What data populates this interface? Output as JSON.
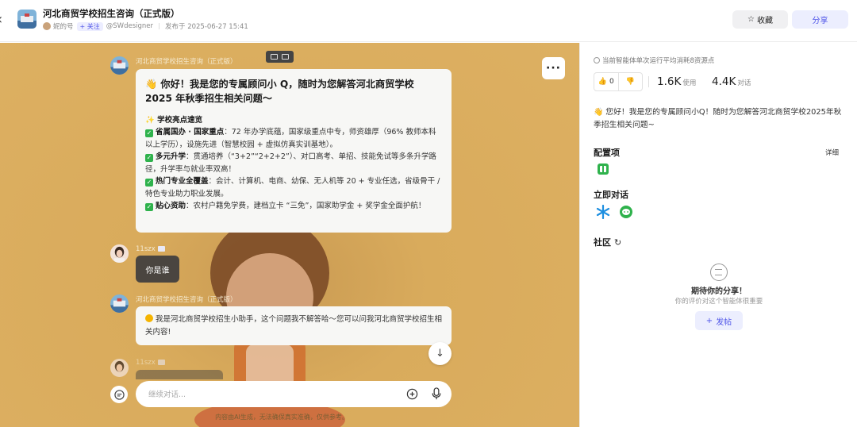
{
  "header": {
    "title": "河北商贸学校招生咨询（正式版）",
    "author": "妮的号",
    "follow_label": "+ 关注",
    "handle": "@SWdesigner",
    "published": "发布于 2025-06-27 15:41",
    "favorite_label": "收藏",
    "share_label": "分享"
  },
  "chat": {
    "bot_name": "河北商贸学校招生咨询（正式版）",
    "user_name": "11szx",
    "welcome": {
      "headline": "你好！我是您的专属顾问小 Q，随时为您解答河北商贸学校 2025 年秋季招生相关问题～",
      "section_title": "学校亮点速览",
      "points": [
        {
          "title": "省属国办 · 国家重点",
          "text": "：72 年办学底蕴，国家级重点中专，师资雄厚（96% 教师本科以上学历），设施先进（智慧校园 + 虚拟仿真实训基地）。"
        },
        {
          "title": "多元升学",
          "text": "：贯通培养（“3+2”“2+2+2”）、对口高考、单招、技能免试等多条升学路径，升学率与就业率双高！"
        },
        {
          "title": "热门专业全覆盖",
          "text": "：会计、计算机、电商、幼保、无人机等 20 + 专业任选，省级骨干 / 特色专业助力职业发展。"
        },
        {
          "title": "贴心资助",
          "text": "：农村户籍免学费，建档立卡 “三免”，国家助学金 + 奖学金全面护航！"
        }
      ]
    },
    "user_message": "你是谁",
    "bot_reply": "我是河北商贸学校招生小助手，这个问题我不解答哈～您可以问我河北商贸学校招生相关内容!",
    "input_placeholder": "继续对话...",
    "disclaimer": "内容由AI生成，无法确保真实准确，仅供参考。"
  },
  "sidebar": {
    "cost_note": "当前智能体单次运行平均消耗8资源点",
    "likes": "0",
    "uses_value": "1.6K",
    "uses_label": "使用",
    "chats_value": "4.4K",
    "chats_label": "对话",
    "greeting": "👋 您好！我是您的专属顾问小Q！随时为您解答河北商贸学校2025年秋季招生相关问题~",
    "config_title": "配置项",
    "detail_label": "详细",
    "talk_title": "立即对话",
    "community_title": "社区",
    "empty_title": "期待你的分享！",
    "empty_sub": "你的评价对这个智能体很重要",
    "post_label": "发帖"
  },
  "colors": {
    "accent": "#4d53e8",
    "chat_background": "#d9ab5c",
    "check_green": "#2fb24c"
  },
  "icons": [
    "back-icon",
    "star-icon",
    "more-icon",
    "arrow-down-icon",
    "plus-circle-icon",
    "mic-icon",
    "thumb-up-icon",
    "thumb-down-icon",
    "info-icon",
    "refresh-icon",
    "comment-icon"
  ]
}
